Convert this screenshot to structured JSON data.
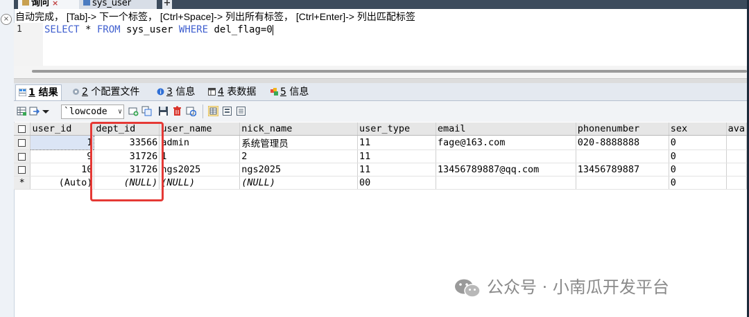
{
  "query_tabs": [
    {
      "label": "询问",
      "close": "×"
    },
    {
      "label": "sys_user"
    }
  ],
  "add_tab": "+",
  "editor": {
    "hint": "自动完成， [Tab]-> 下一个标签， [Ctrl+Space]-> 列出所有标签， [Ctrl+Enter]-> 列出匹配标签",
    "line_number": "1",
    "sql": {
      "kw1": "SELECT",
      "p1": " * ",
      "kw2": "FROM",
      "p2": " sys_user ",
      "kw3": "WHERE",
      "p3": " del_flag=0"
    }
  },
  "result_tabs": [
    {
      "num": "1",
      "label": " 结果"
    },
    {
      "num": "2",
      "label": " 个配置文件"
    },
    {
      "num": "3",
      "label": " 信息"
    },
    {
      "num": "4",
      "label": " 表数据"
    },
    {
      "num": "5",
      "label": " 信息"
    }
  ],
  "toolbar": {
    "select_value": "`lowcode",
    "select_arrow": "∨"
  },
  "grid": {
    "columns": [
      "user_id",
      "dept_id",
      "user_name",
      "nick_name",
      "user_type",
      "email",
      "phonenumber",
      "sex",
      "ava"
    ],
    "rows": [
      [
        "1",
        "33566",
        "admin",
        "系统管理员",
        "11",
        "fage@163.com",
        "020-8888888",
        "0",
        ""
      ],
      [
        "9",
        "31726",
        "1",
        "2",
        "11",
        "",
        "",
        "0",
        ""
      ],
      [
        "10",
        "31726",
        "ngs2025",
        "ngs2025",
        "11",
        "13456789887@qq.com",
        "13456789887",
        "0",
        ""
      ]
    ],
    "new_row": [
      "(Auto)",
      "(NULL)",
      "(NULL)",
      "(NULL)",
      "00",
      "",
      "",
      "0",
      ""
    ],
    "new_row_marker": "*"
  },
  "watermark": "公众号 · 小南瓜开发平台",
  "colors": {
    "highlight_box": "#e53935",
    "keyword": "#3f5fcf"
  }
}
